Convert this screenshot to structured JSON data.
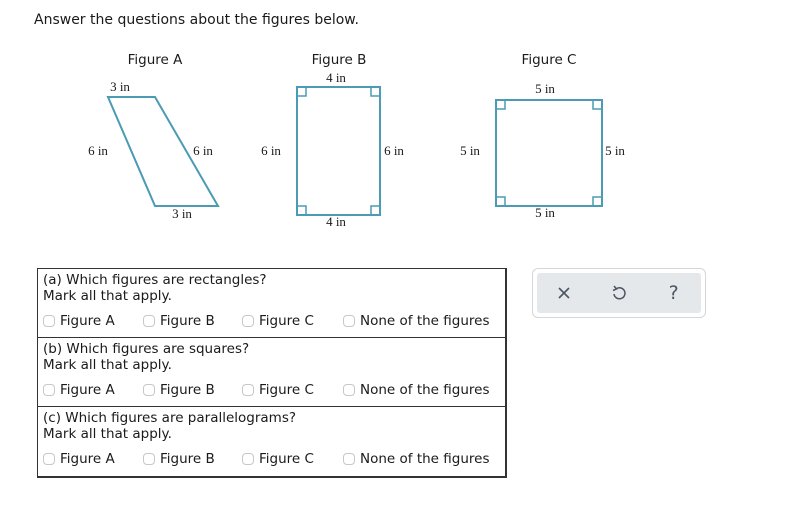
{
  "instruction": "Answer the questions about the figures below.",
  "figures": [
    {
      "title": "Figure A",
      "shape": "parallelogram",
      "sides": {
        "top": "3 in",
        "bottom": "3 in",
        "left": "6 in",
        "right": "6 in"
      },
      "right_angle_marks": false
    },
    {
      "title": "Figure B",
      "shape": "rectangle",
      "sides": {
        "top": "4 in",
        "bottom": "4 in",
        "left": "6 in",
        "right": "6 in"
      },
      "right_angle_marks": true
    },
    {
      "title": "Figure C",
      "shape": "square",
      "sides": {
        "top": "5 in",
        "bottom": "5 in",
        "left": "5 in",
        "right": "5 in"
      },
      "right_angle_marks": true
    }
  ],
  "colors": {
    "shape_stroke": "#4a9bb3",
    "table_border": "#333333",
    "toolbar_bg": "#e5e8eb",
    "icon": "#4b5563"
  },
  "questions": [
    {
      "label": "(a) Which figures are rectangles?",
      "instruction": "Mark all that apply.",
      "options": [
        {
          "label": "Figure A",
          "checked": false
        },
        {
          "label": "Figure B",
          "checked": false
        },
        {
          "label": "Figure C",
          "checked": false
        },
        {
          "label": "None of the figures",
          "checked": false
        }
      ]
    },
    {
      "label": "(b) Which figures are squares?",
      "instruction": "Mark all that apply.",
      "options": [
        {
          "label": "Figure A",
          "checked": false
        },
        {
          "label": "Figure B",
          "checked": false
        },
        {
          "label": "Figure C",
          "checked": false
        },
        {
          "label": "None of the figures",
          "checked": false
        }
      ]
    },
    {
      "label": "(c) Which figures are parallelograms?",
      "instruction": "Mark all that apply.",
      "options": [
        {
          "label": "Figure A",
          "checked": false
        },
        {
          "label": "Figure B",
          "checked": false
        },
        {
          "label": "Figure C",
          "checked": false
        },
        {
          "label": "None of the figures",
          "checked": false
        }
      ]
    }
  ],
  "toolbar": {
    "buttons": [
      {
        "name": "clear",
        "icon": "close-icon"
      },
      {
        "name": "undo",
        "icon": "undo-icon"
      },
      {
        "name": "help",
        "icon": "help-icon",
        "glyph": "?"
      }
    ]
  }
}
